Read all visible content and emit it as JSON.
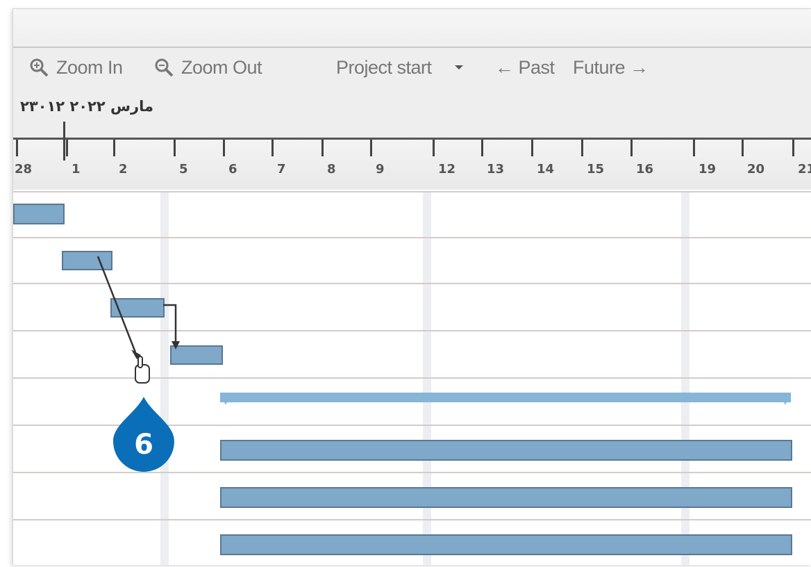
{
  "toolbar": {
    "zoom_in_label": "Zoom In",
    "zoom_out_label": "Zoom Out",
    "project_start_label": "Project start",
    "past_label": "← Past",
    "future_label": "Future →"
  },
  "timescale": {
    "date_label": "مارس ۲۰۲۲ ۲۳۰۱۲",
    "days": [
      "28",
      "1",
      "2",
      "5",
      "6",
      "7",
      "8",
      "9",
      "12",
      "13",
      "14",
      "15",
      "16",
      "19",
      "20",
      "21"
    ]
  },
  "callout": {
    "number": "6"
  },
  "colors": {
    "task_bar": "#7fa8c9",
    "summary_bar": "#86b5d8",
    "callout": "#0a6fb8"
  }
}
